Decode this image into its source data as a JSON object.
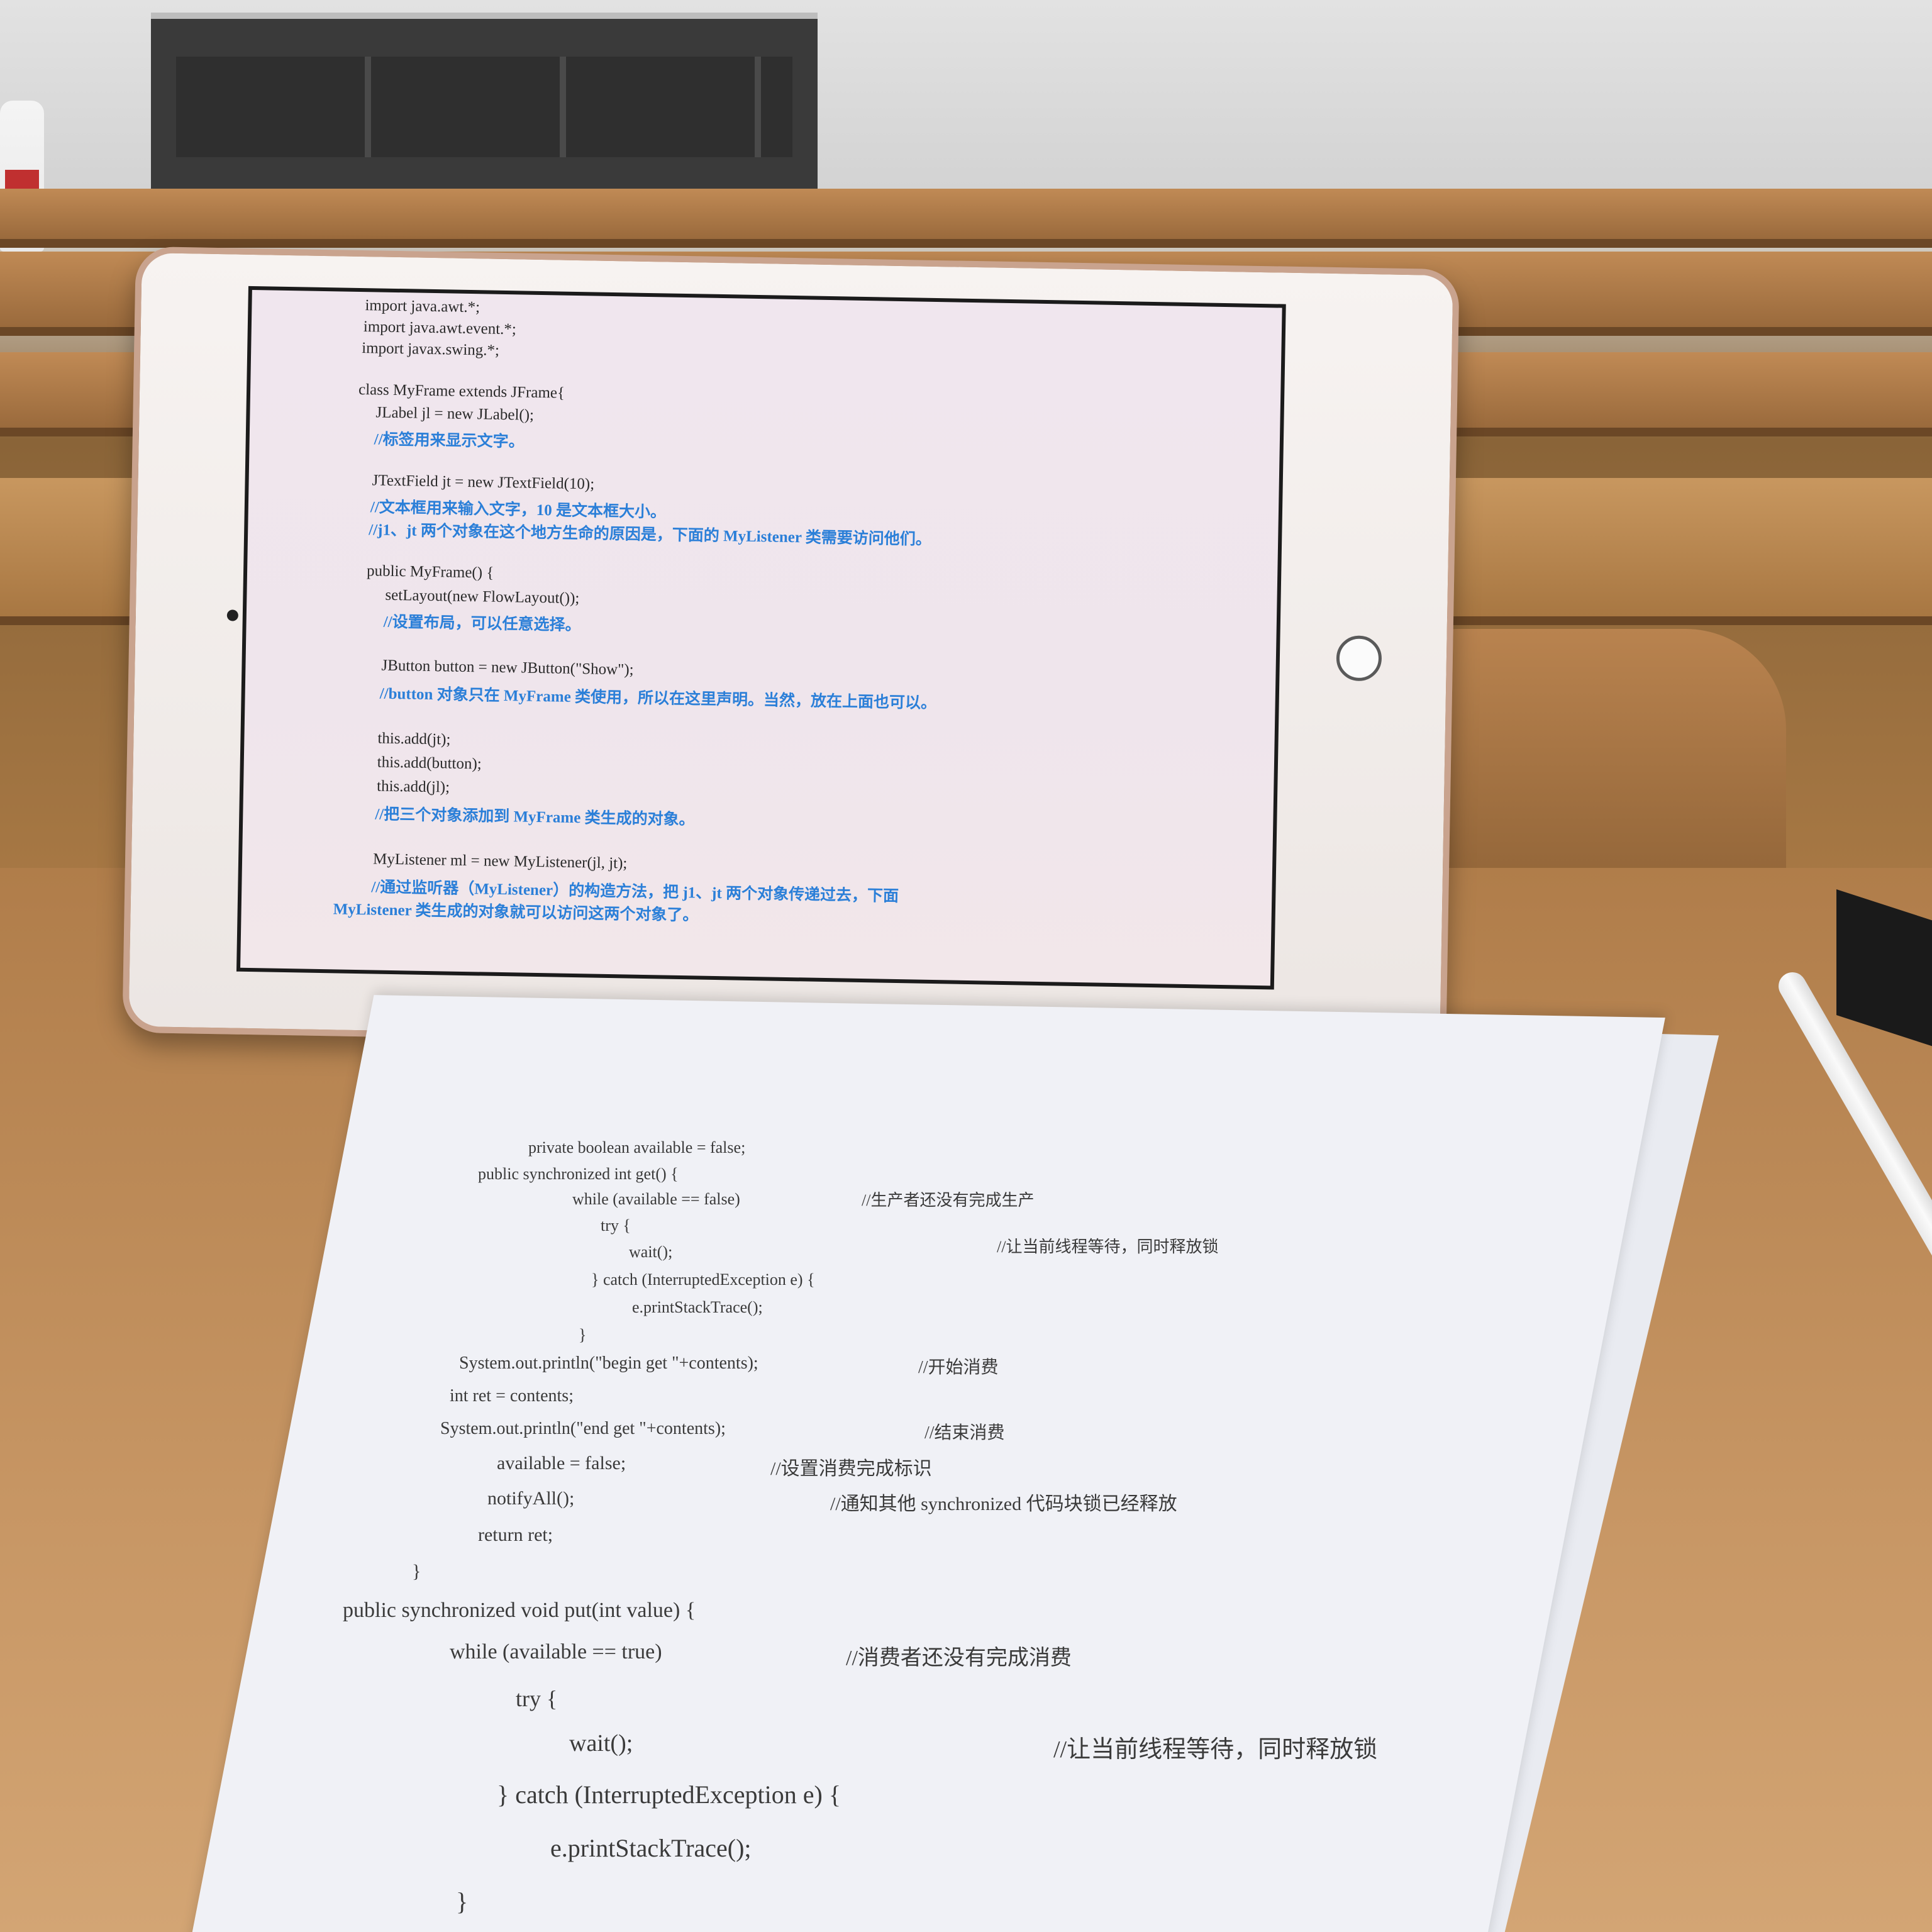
{
  "tablet_code": [
    {
      "text": "import java.awt.*;",
      "comment": false
    },
    {
      "text": "import java.awt.event.*;",
      "comment": false
    },
    {
      "text": "import javax.swing.*;",
      "comment": false
    },
    {
      "text": "class MyFrame extends JFrame{",
      "comment": false
    },
    {
      "text": "JLabel jl = new JLabel();",
      "comment": false
    },
    {
      "text": "//标签用来显示文字。",
      "comment": true
    },
    {
      "text": "JTextField jt = new JTextField(10);",
      "comment": false
    },
    {
      "text": "//文本框用来输入文字，10 是文本框大小。",
      "comment": true
    },
    {
      "text": "//j1、jt 两个对象在这个地方生命的原因是，下面的 MyListener 类需要访问他们。",
      "comment": true
    },
    {
      "text": "public MyFrame() {",
      "comment": false
    },
    {
      "text": "setLayout(new FlowLayout());",
      "comment": false
    },
    {
      "text": "//设置布局，可以任意选择。",
      "comment": true
    },
    {
      "text": "JButton button = new JButton(\"Show\");",
      "comment": false
    },
    {
      "text": "//button 对象只在 MyFrame 类使用，所以在这里声明。当然，放在上面也可以。",
      "comment": true
    },
    {
      "text": "this.add(jt);",
      "comment": false
    },
    {
      "text": "this.add(button);",
      "comment": false
    },
    {
      "text": "this.add(jl);",
      "comment": false
    },
    {
      "text": "//把三个对象添加到 MyFrame 类生成的对象。",
      "comment": true
    },
    {
      "text": "MyListener ml = new MyListener(jl, jt);",
      "comment": false
    },
    {
      "text": "//通过监听器（MyListener）的构造方法，把 j1、jt 两个对象传递过去，下面",
      "comment": true
    },
    {
      "text": "MyListener 类生成的对象就可以访问这两个对象了。",
      "comment": true
    }
  ],
  "paper_code": [
    "private boolean available = false;",
    "public synchronized int get() {",
    "while (available == false)",
    "//生产者还没有完成生产",
    "try {",
    "wait();",
    "//让当前线程等待，同时释放锁",
    "} catch (InterruptedException e) {",
    "e.printStackTrace();",
    "}",
    "System.out.println(\"begin get \"+contents);",
    "//开始消费",
    "int ret = contents;",
    "System.out.println(\"end get \"+contents);",
    "//结束消费",
    "available = false;",
    "//设置消费完成标识",
    "notifyAll();",
    "//通知其他 synchronized 代码块锁已经释放",
    "return ret;",
    "}",
    "public synchronized void put(int value) {",
    "while (available == true)",
    "//消费者还没有完成消费",
    "try {",
    "wait();",
    "//让当前线程等待，同时释放锁",
    "} catch (InterruptedException e) {",
    "e.printStackTrace();",
    "}"
  ],
  "colors": {
    "comment": "#2b7fd8",
    "code": "#2a2a2a",
    "desk": "#b98a58"
  }
}
